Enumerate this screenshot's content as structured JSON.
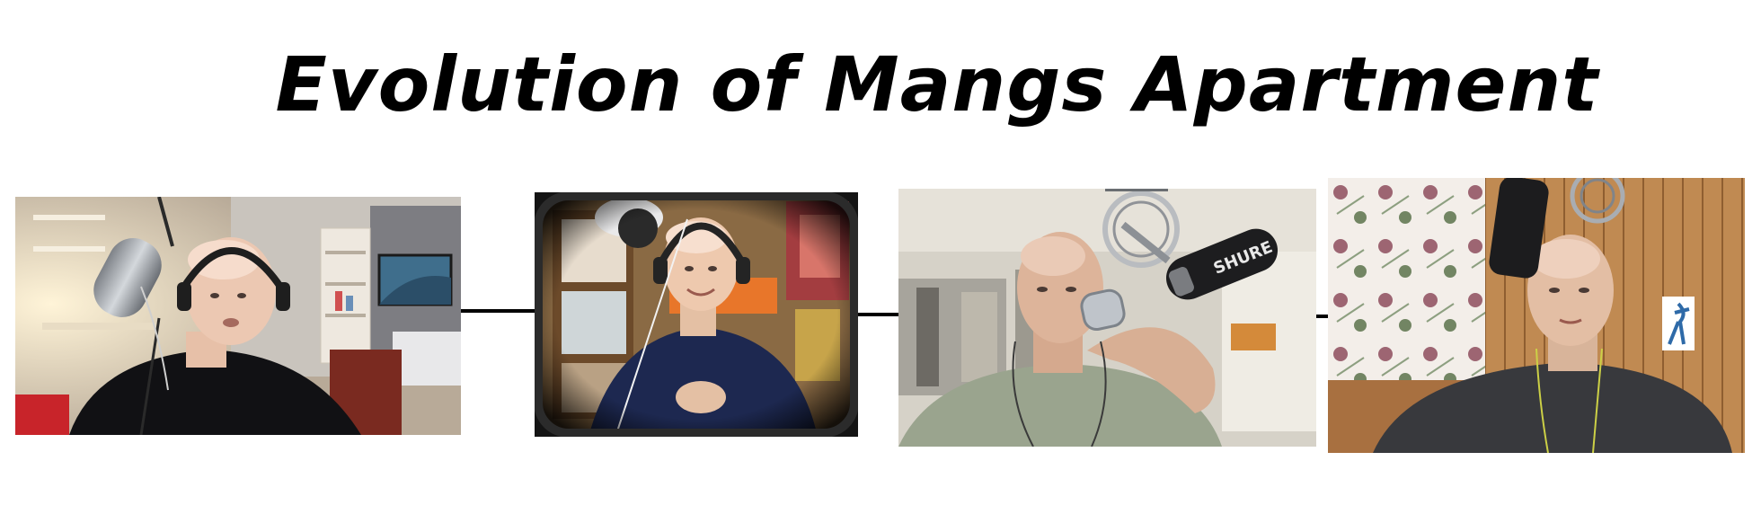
{
  "title": "Evolution of Mangs Apartment",
  "photos": [
    {
      "icon": "webcam-still-photo",
      "subject": "man with headphones and condenser microphone in white room"
    },
    {
      "icon": "webcam-still-photo",
      "subject": "man with headphones in old TV frame"
    },
    {
      "icon": "webcam-still-photo",
      "subject": "man drinking from can with broadcast microphone"
    },
    {
      "icon": "webcam-still-photo",
      "subject": "man in wood-paneled room with floral curtains"
    }
  ],
  "microphone_brand_text": "SHURE",
  "colors": {
    "background": "#ffffff",
    "title": "#000000",
    "connector": "#000000"
  }
}
